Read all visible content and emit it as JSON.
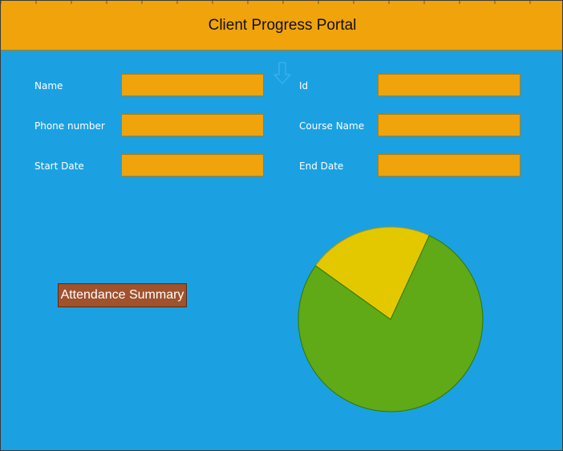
{
  "header": {
    "title": "Client Progress Portal"
  },
  "form": {
    "name_label": "Name",
    "name_value": "",
    "id_label": "Id",
    "id_value": "",
    "phone_label": "Phone number",
    "phone_value": "",
    "course_label": "Course Name",
    "course_value": "",
    "start_label": "Start Date",
    "start_value": "",
    "end_label": "End Date",
    "end_value": ""
  },
  "actions": {
    "summary_label": "Attendance Summary"
  },
  "icons": {
    "arrow": "arrow-down-icon"
  },
  "colors": {
    "background": "#1ba1e2",
    "header": "#f0a30a",
    "field": "#f0a30a",
    "button": "#a0522d"
  },
  "chart_data": {
    "type": "pie",
    "title": "",
    "slices": [
      {
        "label": "",
        "value": 22,
        "color": "#e3c800"
      },
      {
        "label": "",
        "value": 78,
        "color": "#60a917"
      }
    ]
  }
}
